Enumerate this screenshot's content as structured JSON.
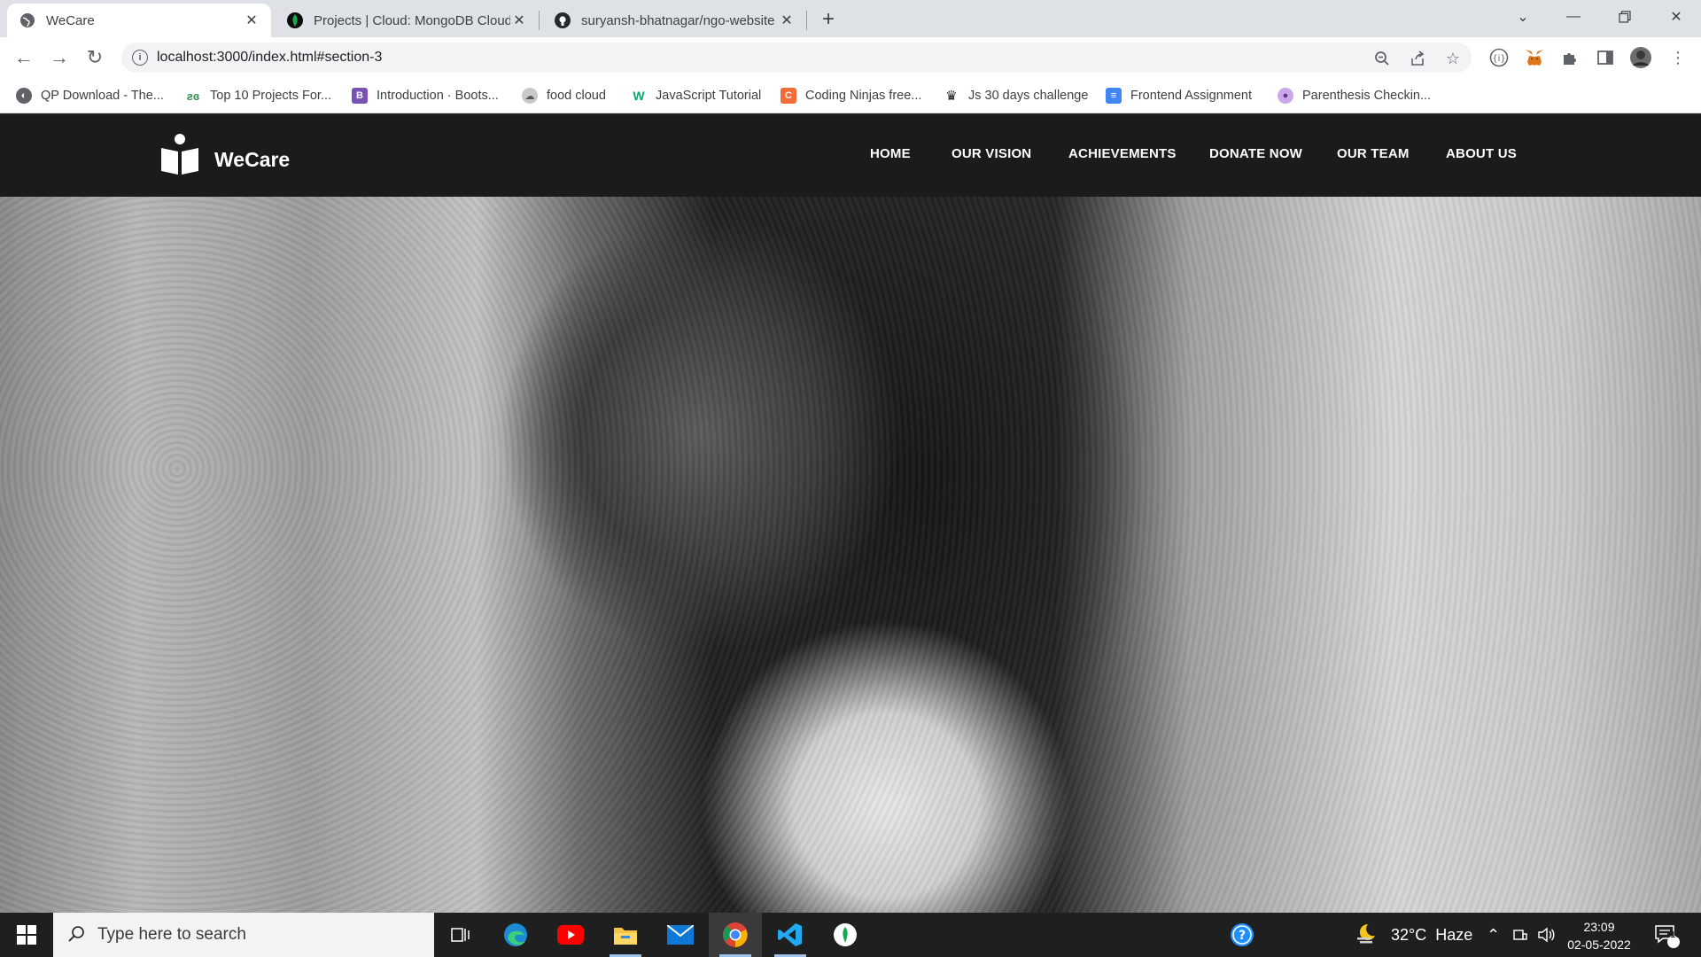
{
  "browser": {
    "tabs": [
      {
        "title": "WeCare",
        "active": true
      },
      {
        "title": "Projects | Cloud: MongoDB Cloud",
        "active": false
      },
      {
        "title": "suryansh-bhatnagar/ngo-website",
        "active": false
      }
    ],
    "url": "localhost:3000/index.html#section-3",
    "bookmarks": [
      {
        "label": "QP Download - The...",
        "icon": "globe-icon"
      },
      {
        "label": "Top 10 Projects For...",
        "icon": "gfg-icon"
      },
      {
        "label": "Introduction · Boots...",
        "icon": "bootstrap-icon"
      },
      {
        "label": "food cloud",
        "icon": "food-cloud-icon"
      },
      {
        "label": "JavaScript Tutorial",
        "icon": "w3schools-icon"
      },
      {
        "label": "Coding Ninjas free...",
        "icon": "coding-ninjas-icon"
      },
      {
        "label": "Js 30 days challenge",
        "icon": "crown-icon"
      },
      {
        "label": "Frontend Assignment",
        "icon": "docs-icon"
      },
      {
        "label": "Parenthesis Checkin...",
        "icon": "avatar-icon"
      }
    ]
  },
  "site": {
    "logo_text": "WeCare",
    "nav": [
      "HOME",
      "OUR VISION",
      "ACHIEVEMENTS",
      "DONATE NOW",
      "OUR TEAM",
      "ABOUT US"
    ]
  },
  "taskbar": {
    "search_placeholder": "Type here to search",
    "weather": "32°C  Haze",
    "time": "23:09",
    "date": "02-05-2022",
    "notification_count": "16"
  },
  "colors": {
    "nav_bg": "#1b1b1b",
    "tab_strip": "#dee1e6",
    "taskbar_bg": "#1f1f1f"
  }
}
